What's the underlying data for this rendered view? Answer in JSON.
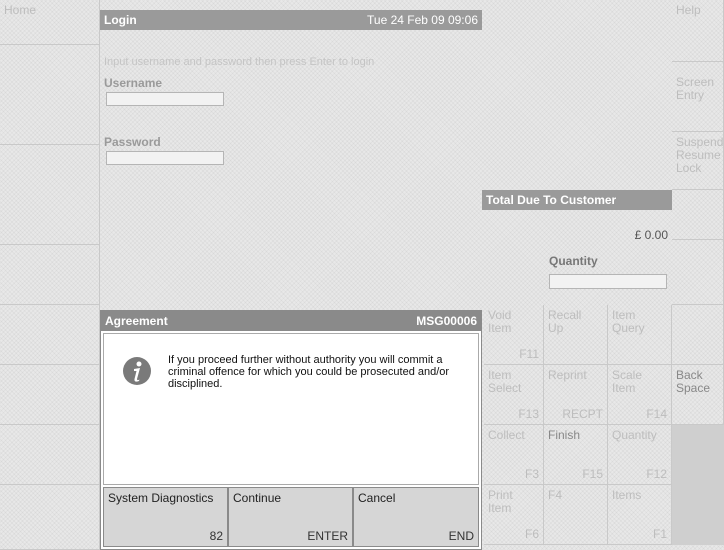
{
  "left_column": {
    "home": "Home"
  },
  "login": {
    "title": "Login",
    "datetime": "Tue 24 Feb 09  09:06",
    "instruction": "Input username and password then press Enter to login",
    "username_label": "Username",
    "password_label": "Password"
  },
  "total": {
    "header": "Total Due To Customer",
    "amount": "£ 0.00",
    "quantity_label": "Quantity"
  },
  "right_column": {
    "help": "Help",
    "screen_entry": "Screen\nEntry",
    "suspend": "Suspend\nResume\nLock",
    "back_space": "Back\nSpace"
  },
  "keypad": [
    {
      "label": "Void\nItem",
      "key": "F11"
    },
    {
      "label": "Recall\nUp",
      "key": ""
    },
    {
      "label": "Item\nQuery",
      "key": ""
    },
    {
      "label": "Item\nSelect",
      "key": "F13"
    },
    {
      "label": "Reprint",
      "key": "RECPT"
    },
    {
      "label": "Scale\nItem",
      "key": "F14"
    },
    {
      "label": "Collect",
      "key": "F3"
    },
    {
      "label": "Finish",
      "key": "F15"
    },
    {
      "label": "Quantity",
      "key": "F12"
    },
    {
      "label": "Print\nItem",
      "key": "F6"
    },
    {
      "label": "F4",
      "key": ""
    },
    {
      "label": "Items",
      "key": "F1"
    }
  ],
  "dialog": {
    "title": "Agreement",
    "code": "MSG00006",
    "message": "If you proceed further without authority you will commit a criminal offence for which you could be prosecuted and/or disciplined.",
    "icon": "info-icon"
  },
  "buttons": {
    "diagnostics_label": "System Diagnostics",
    "diagnostics_key": "82",
    "continue_label": "Continue",
    "continue_key": "ENTER",
    "cancel_label": "Cancel",
    "cancel_key": "END"
  }
}
